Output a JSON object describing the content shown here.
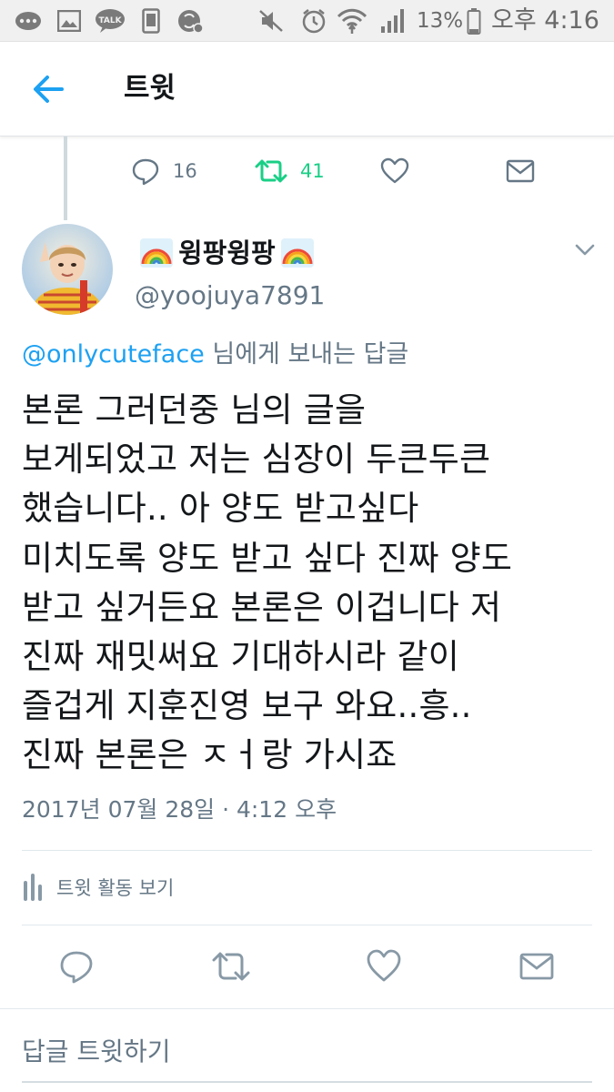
{
  "status_bar": {
    "battery": "13%",
    "time": "오후 4:16"
  },
  "header": {
    "title": "트윗"
  },
  "parent_tweet": {
    "reply_count": "16",
    "retweet_count": "41"
  },
  "tweet": {
    "display_name": "윙팡윙팡",
    "handle": "@yoojuya7891",
    "reply_to_mention": "@onlycuteface",
    "reply_to_suffix": " 님에게 보내는 답글",
    "text": "본론 그러던중 님의 글을\n보게되었고 저는 심장이 두큰두큰\n했습니다.. 아 양도 받고싶다\n미치도록 양도 받고 싶다 진짜 양도\n받고 싶거든요 본론은 이겁니다 저\n진짜 재밋써요 기대하시라 같이\n즐겁게 지훈진영 보구 와요..흥..\n진짜 본론은 ㅈㅓ랑 가시죠",
    "timestamp": "2017년 07월 28일 · 4:12 오후"
  },
  "activity": {
    "label": "트윗 활동 보기"
  },
  "reply_box": {
    "placeholder": "답글 트윗하기"
  },
  "colors": {
    "accent": "#1da1f2",
    "retweet": "#19cf86",
    "secondary_text": "#657786"
  }
}
